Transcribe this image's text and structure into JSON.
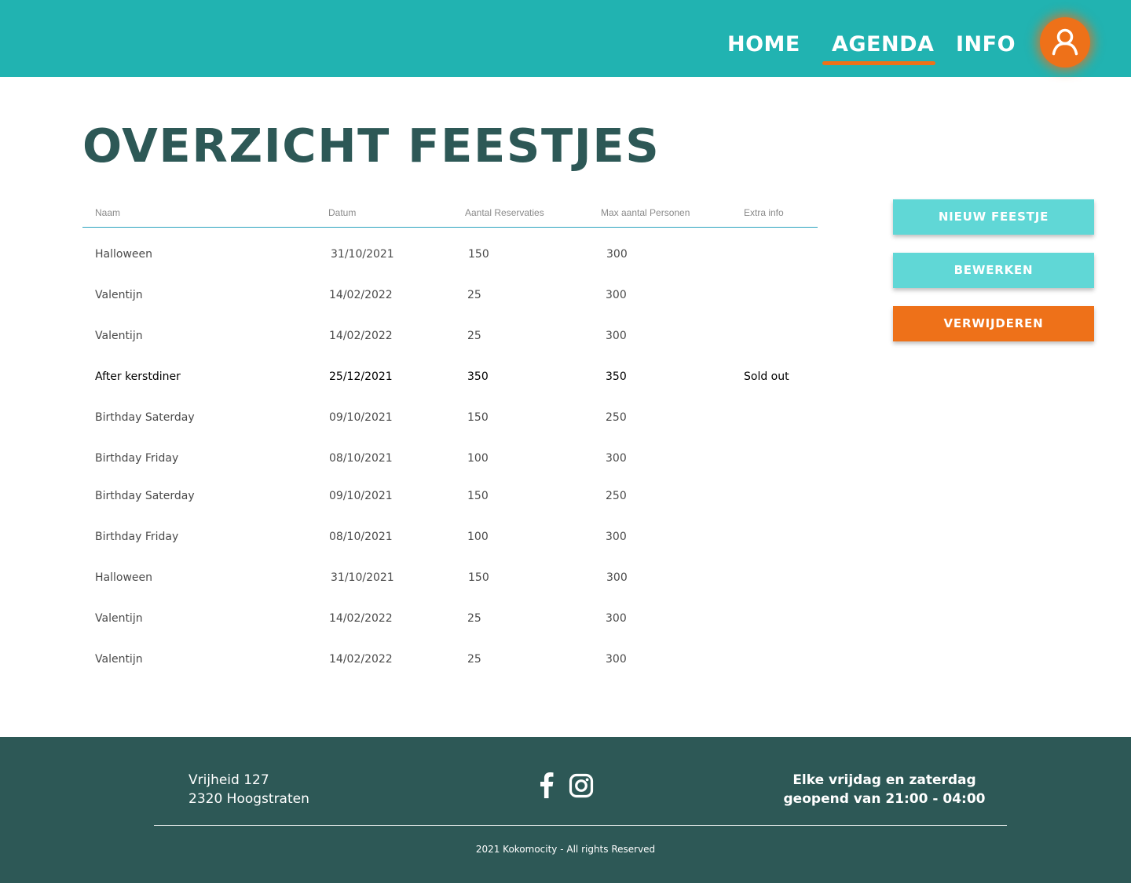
{
  "colors": {
    "header_bg": "#21b3b1",
    "accent_orange": "#ee7119",
    "button_teal": "#60d7d6",
    "title_text": "#2d5856",
    "footer_bg": "#2d5856",
    "table_rule": "#2ba3bf"
  },
  "nav": {
    "items": [
      {
        "label": "HOME",
        "active": false
      },
      {
        "label": "AGENDA",
        "active": true
      },
      {
        "label": "INFO",
        "active": false
      }
    ],
    "account_icon": "user-icon"
  },
  "page": {
    "title": "OVERZICHT FEESTJES"
  },
  "table": {
    "columns": [
      "Naam",
      "Datum",
      "Aantal Reservaties",
      "Max aantal Personen",
      "Extra info"
    ],
    "rows": [
      {
        "name": "Halloween",
        "date": "31/10/2021",
        "reservations": "150",
        "max": "300",
        "extra": ""
      },
      {
        "name": "Valentijn",
        "date": "14/02/2022",
        "reservations": "25",
        "max": "300",
        "extra": ""
      },
      {
        "name": "Valentijn",
        "date": "14/02/2022",
        "reservations": "25",
        "max": "300",
        "extra": ""
      },
      {
        "name": "After kerstdiner",
        "date": "25/12/2021",
        "reservations": "350",
        "max": "350",
        "extra": "Sold out",
        "highlighted": true
      },
      {
        "name": "Birthday Saterday",
        "date": "09/10/2021",
        "reservations": "150",
        "max": "250",
        "extra": ""
      },
      {
        "name": "Birthday Friday",
        "date": "08/10/2021",
        "reservations": "100",
        "max": "300",
        "extra": ""
      },
      {
        "name": "Birthday Saterday",
        "date": "09/10/2021",
        "reservations": "150",
        "max": "250",
        "extra": ""
      },
      {
        "name": "Birthday Friday",
        "date": "08/10/2021",
        "reservations": "100",
        "max": "300",
        "extra": ""
      },
      {
        "name": "Halloween",
        "date": "31/10/2021",
        "reservations": "150",
        "max": "300",
        "extra": ""
      },
      {
        "name": "Valentijn",
        "date": "14/02/2022",
        "reservations": "25",
        "max": "300",
        "extra": ""
      },
      {
        "name": "Valentijn",
        "date": "14/02/2022",
        "reservations": "25",
        "max": "300",
        "extra": ""
      }
    ]
  },
  "actions": {
    "new_label": "NIEUW FEESTJE",
    "edit_label": "BEWERKEN",
    "delete_label": "VERWIJDEREN"
  },
  "footer": {
    "address_line1": "Vrijheid 127",
    "address_line2": "2320 Hoogstraten",
    "social_icons": [
      "facebook-icon",
      "instagram-icon"
    ],
    "hours_line1": "Elke vrijdag en zaterdag",
    "hours_line2": "geopend van 21:00 - 04:00",
    "copyright": "2021 Kokomocity - All rights Reserved"
  }
}
